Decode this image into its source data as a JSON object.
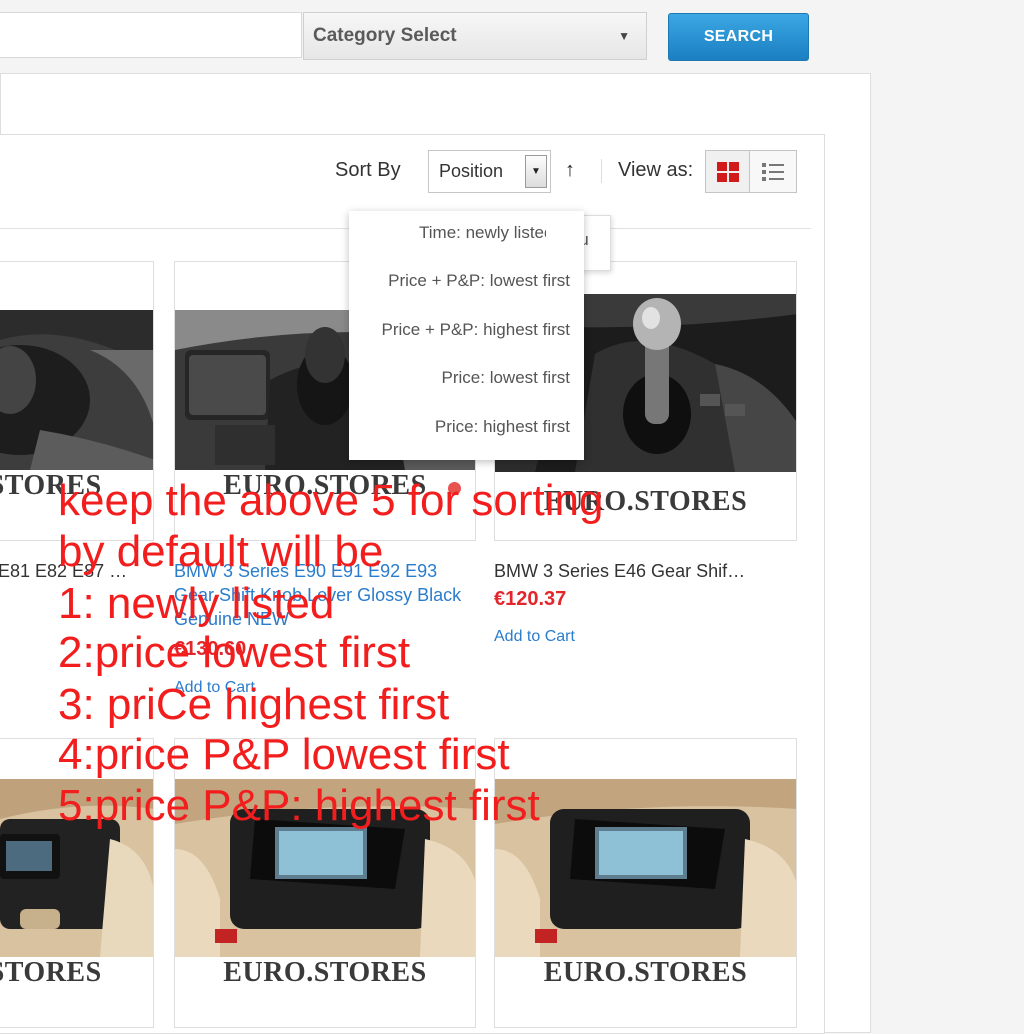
{
  "header": {
    "search_placeholder": "",
    "category_select": "Category Select",
    "search_button": "SEARCH"
  },
  "toolbar": {
    "sort_by_label": "Sort By",
    "sort_value": "Position",
    "sort_direction_icon": "arrow-up-icon",
    "view_as_label": "View as:",
    "view_modes": [
      "grid",
      "list"
    ],
    "active_view": "grid",
    "accent_color": "#d11a1a"
  },
  "sort_menu": {
    "options": [
      "Time: newly listed",
      "Price + P&P: lowest first",
      "Price + P&P: highest first",
      "Price: lowest first",
      "Price: highest first"
    ],
    "submenu_partial": "Cu"
  },
  "products": [
    {
      "brand": "EURO.STORES",
      "name": "E81 E82 E87 …",
      "price": "",
      "add_to_cart": ""
    },
    {
      "brand": "EURO.STORES",
      "name": "BMW 3 Series E90 E91 E92 E93 Gear Shift Knob Lever Glossy Black Genuine NEW",
      "price": "€130.60",
      "add_to_cart": "Add to Cart"
    },
    {
      "brand": "EURO.STORES",
      "name": "BMW 3 Series E46 Gear Shif…",
      "price": "€120.37",
      "add_to_cart": "Add to Cart"
    },
    {
      "brand": "EURO.STORES"
    },
    {
      "brand": "EURO.STORES"
    },
    {
      "brand": "EURO.STORES"
    }
  ],
  "annotation": {
    "lines": [
      "keep the above 5 for sorting",
      "by default will be",
      "1: newly listed",
      "2:price lowest first",
      "3: priCe highest first",
      "4:price P&P lowest first",
      "5:price P&P: highest first"
    ],
    "color": "#f21d1d"
  }
}
